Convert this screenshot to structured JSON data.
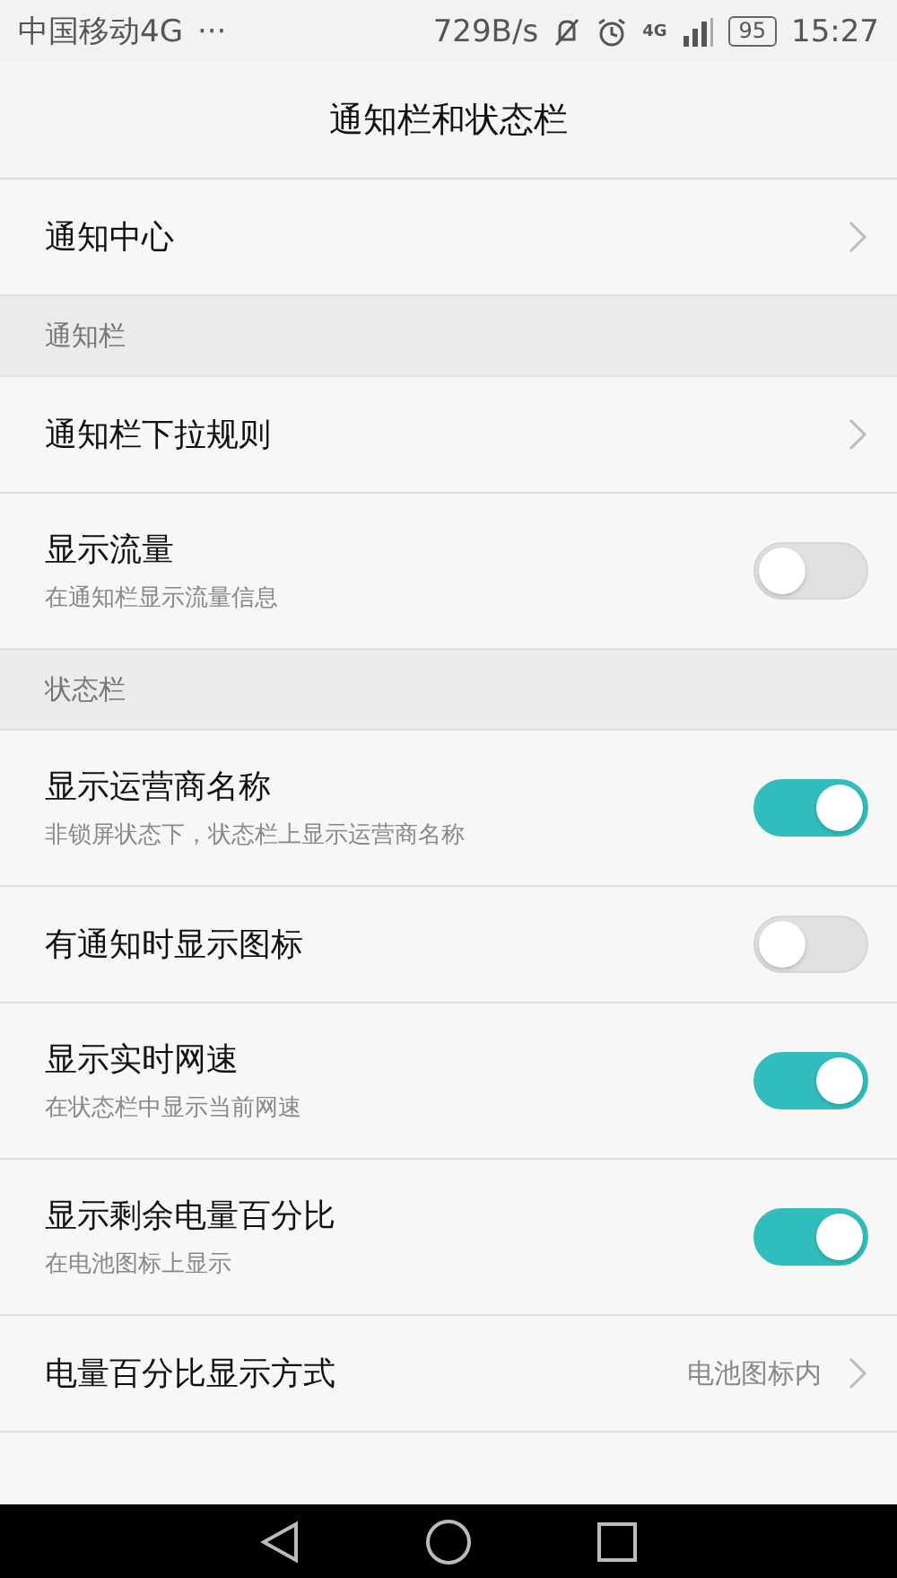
{
  "status_bar": {
    "carrier": "中国移动4G",
    "more": "···",
    "speed": "729B/s",
    "network_label": "4G",
    "battery": "95",
    "time": "15:27"
  },
  "header": {
    "title": "通知栏和状态栏"
  },
  "items": [
    {
      "kind": "link",
      "label": "通知中心"
    },
    {
      "kind": "section",
      "label": "通知栏"
    },
    {
      "kind": "link",
      "label": "通知栏下拉规则"
    },
    {
      "kind": "toggle",
      "label": "显示流量",
      "description": "在通知栏显示流量信息",
      "on": false
    },
    {
      "kind": "section",
      "label": "状态栏"
    },
    {
      "kind": "toggle",
      "label": "显示运营商名称",
      "description": "非锁屏状态下，状态栏上显示运营商名称",
      "on": true
    },
    {
      "kind": "toggle",
      "label": "有通知时显示图标",
      "on": false
    },
    {
      "kind": "toggle",
      "label": "显示实时网速",
      "description": "在状态栏中显示当前网速",
      "on": true
    },
    {
      "kind": "toggle",
      "label": "显示剩余电量百分比",
      "description": "在电池图标上显示",
      "on": true
    },
    {
      "kind": "link",
      "label": "电量百分比显示方式",
      "value": "电池图标内"
    }
  ]
}
